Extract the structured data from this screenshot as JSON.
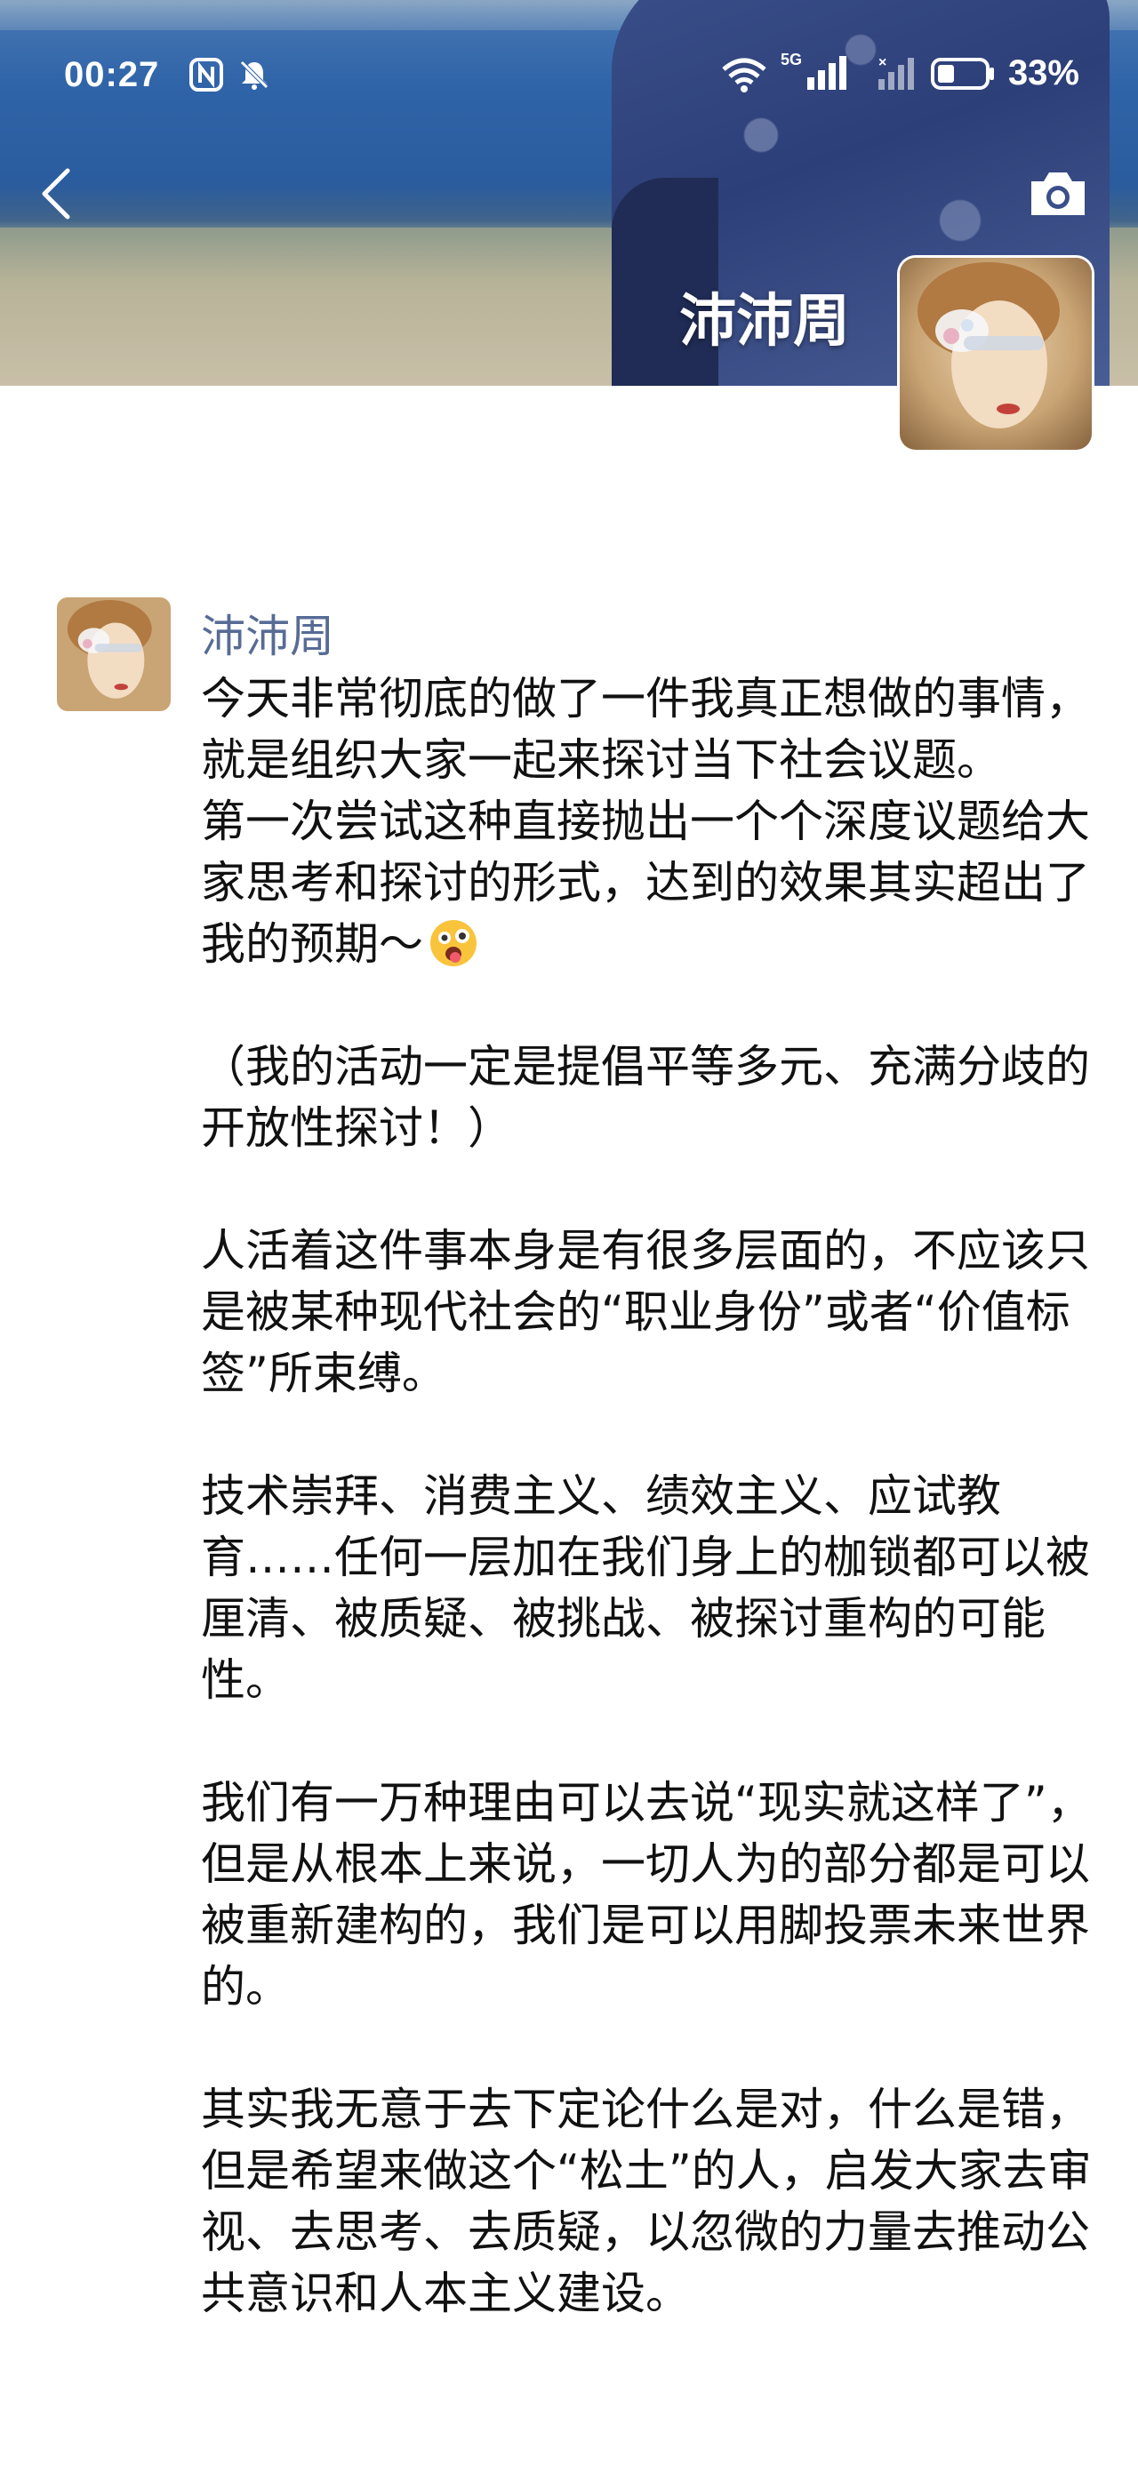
{
  "status_bar": {
    "time": "00:27",
    "network": "5G",
    "battery": "33%"
  },
  "header": {
    "back_icon": "chevron-left-icon",
    "camera_icon": "camera-icon",
    "profile_name": "沛沛周"
  },
  "post": {
    "author": "沛沛周",
    "paragraphs": [
      "今天非常彻底的做了一件我真正想做的事情，就是组织大家一起来探讨当下社会议题。",
      "第一次尝试这种直接抛出一个个深度议题给大家思考和探讨的形式，达到的效果其实超出了我的预期～",
      "（我的活动一定是提倡平等多元、充满分歧的开放性探讨！）",
      "人活着这件事本身是有很多层面的，不应该只是被某种现代社会的“职业身份”或者“价值标签”所束缚。",
      "技术崇拜、消费主义、绩效主义、应试教育……任何一层加在我们身上的枷锁都可以被厘清、被质疑、被挑战、被探讨重构的可能性。",
      "我们有一万种理由可以去说“现实就这样了”，",
      "但是从根本上来说，一切人为的部分都是可以被重新建构的，我们是可以用脚投票未来世界的。",
      "其实我无意于去下定论什么是对，什么是错，但是希望来做这个“松土”的人，启发大家去审视、去思考、去质疑，以忽微的力量去推动公共意识和人本主义建设。"
    ],
    "emoji_icon": "tongue-out-emoji-icon"
  }
}
